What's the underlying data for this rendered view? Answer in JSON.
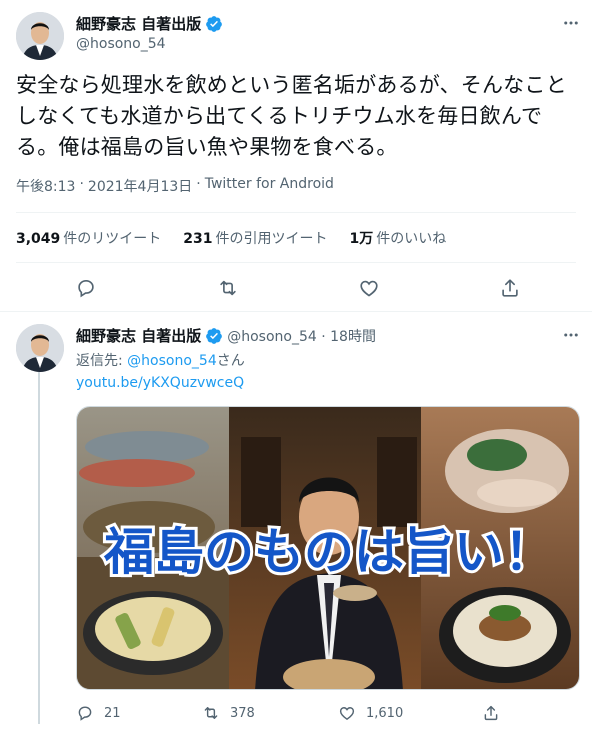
{
  "main_tweet": {
    "author_name": "細野豪志 自著出版",
    "author_handle": "@hosono_54",
    "text": "安全なら処理水を飲めという匿名垢があるが、そんなことしなくても水道から出てくるトリチウム水を毎日飲んでる。俺は福島の旨い魚や果物を食べる。",
    "time": "午後8:13",
    "date": "2021年4月13日",
    "source": "Twitter for Android",
    "separator": "·",
    "stats": [
      {
        "num": "3,049",
        "label": "件のリツイート"
      },
      {
        "num": "231",
        "label": "件の引用ツイート"
      },
      {
        "num": "1万",
        "label": "件のいいね"
      }
    ]
  },
  "reply_tweet": {
    "author_name": "細野豪志 自著出版",
    "handle_time": "@hosono_54 · 18時間",
    "reply_prefix": "返信先: ",
    "reply_handle": "@hosono_54",
    "reply_suffix": "さん",
    "link": "youtu.be/yKXQuzvwceQ",
    "thumbnail_caption": "福島のものは旨い！",
    "counts": {
      "replies": "21",
      "retweets": "378",
      "likes": "1,610"
    }
  },
  "colors": {
    "accent": "#1d9bf0",
    "muted": "#536471",
    "text": "#0f1419",
    "caption_fill": "#1456c8"
  },
  "icons": [
    "verified-badge-icon",
    "more-icon",
    "reply-icon",
    "retweet-icon",
    "like-icon",
    "share-icon"
  ]
}
